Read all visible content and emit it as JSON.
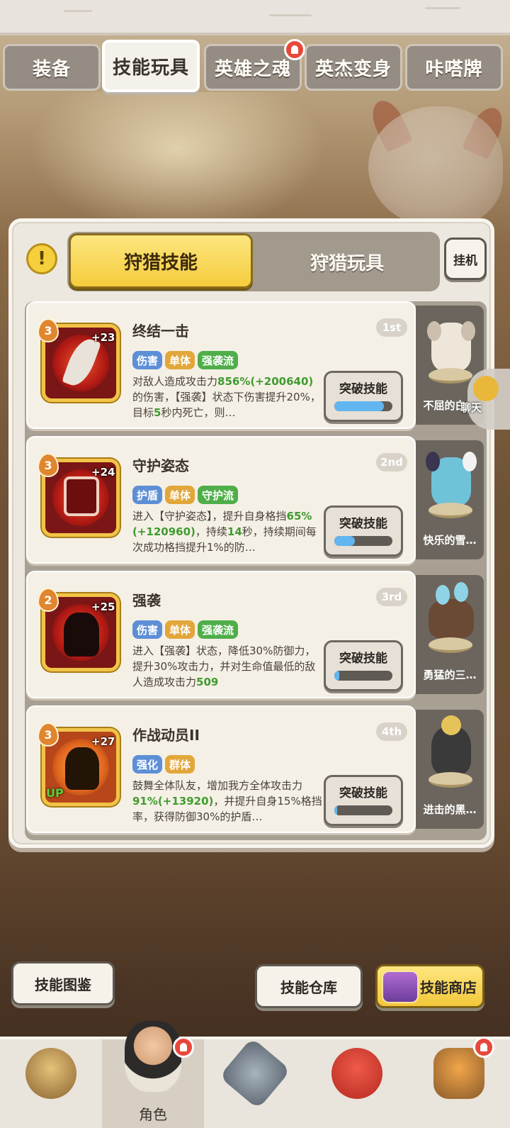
{
  "top_tabs": [
    {
      "label": "装备",
      "active": false,
      "badge": false
    },
    {
      "label": "技能玩具",
      "active": true,
      "badge": false
    },
    {
      "label": "英雄之魂",
      "active": false,
      "badge": true
    },
    {
      "label": "英杰变身",
      "active": false,
      "badge": false
    },
    {
      "label": "咔嗒牌",
      "active": false,
      "badge": false
    }
  ],
  "panel": {
    "info_symbol": "!",
    "segment": {
      "active": "狩猎技能",
      "other": "狩猎玩具"
    },
    "idle_button": "挂机"
  },
  "skills": [
    {
      "name": "终结一击",
      "rank": "1st",
      "level": "3",
      "plus": "+23",
      "up": "",
      "tags": [
        {
          "text": "伤害",
          "color": "blue"
        },
        {
          "text": "单体",
          "color": "orange"
        },
        {
          "text": "强袭流",
          "color": "green"
        }
      ],
      "desc_parts": [
        "对敌人造成攻击力",
        "856%(+200640)",
        "的伤害，【强袭】状态下伤害提升20%，目标",
        "5",
        "秒内死亡，则…"
      ],
      "button": "突破技能",
      "progress": 0.85,
      "pet_name": "不屈的白…",
      "icon_color": "#7a1616",
      "pet_color": "#eee6d8"
    },
    {
      "name": "守护姿态",
      "rank": "2nd",
      "level": "3",
      "plus": "+24",
      "up": "",
      "tags": [
        {
          "text": "护盾",
          "color": "blue"
        },
        {
          "text": "单体",
          "color": "orange"
        },
        {
          "text": "守护流",
          "color": "green"
        }
      ],
      "desc_parts": [
        "进入【守护姿态】，提升自身格挡",
        "65%(+120960)",
        "，持续",
        "14",
        "秒，持续期间每次成功格挡提升1%的防…"
      ],
      "button": "突破技能",
      "progress": 0.35,
      "pet_name": "快乐的雪…",
      "icon_color": "#8f1a1a",
      "pet_color": "#6fc3d9"
    },
    {
      "name": "强袭",
      "rank": "3rd",
      "level": "2",
      "plus": "+25",
      "up": "",
      "tags": [
        {
          "text": "伤害",
          "color": "blue"
        },
        {
          "text": "单体",
          "color": "orange"
        },
        {
          "text": "强袭流",
          "color": "green"
        }
      ],
      "desc_parts": [
        "进入【强袭】状态，降低30%防御力，提升30%攻击力，并对生命值最低的敌人造成攻击力",
        "509",
        ""
      ],
      "button": "突破技能",
      "progress": 0.08,
      "pet_name": "勇猛的三…",
      "icon_color": "#9a1c12",
      "pet_color": "#6a4a35"
    },
    {
      "name": "作战动员II",
      "rank": "4th",
      "level": "3",
      "plus": "+27",
      "up": "UP",
      "tags": [
        {
          "text": "强化",
          "color": "blue"
        },
        {
          "text": "群体",
          "color": "orange"
        }
      ],
      "desc_parts": [
        "鼓舞全体队友，增加我方全体攻击力",
        "91%(+13920)",
        "，并提升自身1",
        "5%格挡率，获得防御30%的护盾…",
        ""
      ],
      "button": "突破技能",
      "progress": 0.05,
      "pet_name": "进击的黑…",
      "icon_color": "#b7461a",
      "pet_color": "#3a3a3a"
    }
  ],
  "chat_label": "聊天",
  "bottom_buttons": {
    "collection": "技能图鉴",
    "warehouse": "技能仓库",
    "shop": "技能商店"
  },
  "nav": [
    {
      "label": "",
      "active": false,
      "badge": false,
      "icon": "mammoth-icon"
    },
    {
      "label": "角色",
      "active": true,
      "badge": true,
      "icon": "hero-icon"
    },
    {
      "label": "",
      "active": false,
      "badge": false,
      "icon": "sword-icon"
    },
    {
      "label": "",
      "active": false,
      "badge": false,
      "icon": "dino-icon"
    },
    {
      "label": "",
      "active": false,
      "badge": true,
      "icon": "totem-icon"
    }
  ]
}
